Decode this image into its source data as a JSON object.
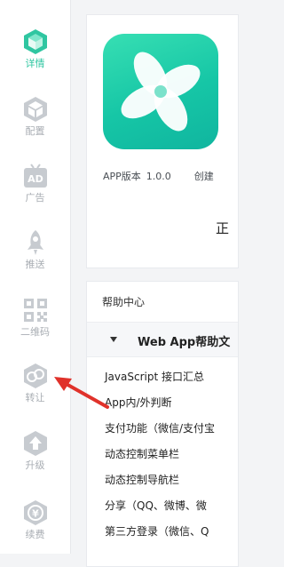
{
  "sidebar": {
    "items": [
      {
        "label": "详情",
        "icon": "cube-icon",
        "active": true
      },
      {
        "label": "配置",
        "icon": "box-icon"
      },
      {
        "label": "广告",
        "icon": "ad-tv-icon",
        "icon_text": "AD"
      },
      {
        "label": "推送",
        "icon": "rocket-icon"
      },
      {
        "label": "二维码",
        "icon": "qrcode-icon"
      },
      {
        "label": "转让",
        "icon": "transfer-icon"
      },
      {
        "label": "升级",
        "icon": "upgrade-icon"
      },
      {
        "label": "续费",
        "icon": "renew-yen-icon",
        "icon_text": "¥"
      }
    ]
  },
  "app_card": {
    "version_label": "APP版本",
    "version_value": "1.0.0",
    "created_label": "创建",
    "status_text": "正"
  },
  "help_center": {
    "title": "帮助中心",
    "section_title": "Web App帮助文",
    "links": [
      "JavaScript 接口汇总",
      "App内/外判断",
      "支付功能（微信/支付宝",
      "动态控制菜单栏",
      "动态控制导航栏",
      "分享（QQ、微博、微",
      "第三方登录（微信、Q"
    ]
  },
  "colors": {
    "accent": "#2fc6a1",
    "inactive_icon": "#c7cbd0",
    "arrow": "#e0322b"
  }
}
